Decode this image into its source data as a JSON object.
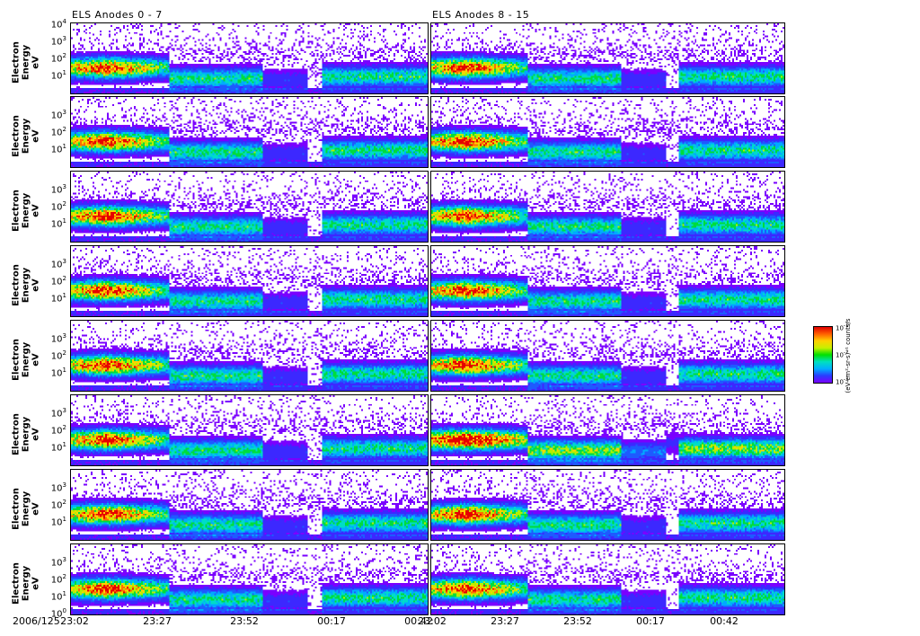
{
  "chart_data": {
    "type": "heatmap",
    "titles": [
      "ELS Anodes 0 - 7",
      "ELS Anodes 8 - 15"
    ],
    "ylabel": "Electron Energy",
    "yunit": "eV",
    "ylim": [
      1,
      10000
    ],
    "yscale": "log",
    "yticks_top": [
      "10",
      "10",
      "10",
      "10"
    ],
    "ytick_exps": [
      "4",
      "3",
      "2",
      "1",
      "0"
    ],
    "date": "2006/125",
    "xticks": [
      "23:02",
      "23:27",
      "23:52",
      "00:17",
      "00:42",
      "23:02",
      "23:27",
      "23:52",
      "00:17",
      "00:42"
    ],
    "rows": 8,
    "columns": 2,
    "colorbar": {
      "ticks": [
        "10",
        "10",
        "10"
      ],
      "exps": [
        "-1",
        "-2",
        "-3"
      ],
      "label": "(eV-cm²-sr-s)⁻¹ counts/s"
    },
    "colors": [
      "#7a00ff",
      "#2a3cff",
      "#00b0ff",
      "#00e0c0",
      "#00e000",
      "#c8f000",
      "#ffd000",
      "#ff6000",
      "#e00000"
    ]
  }
}
